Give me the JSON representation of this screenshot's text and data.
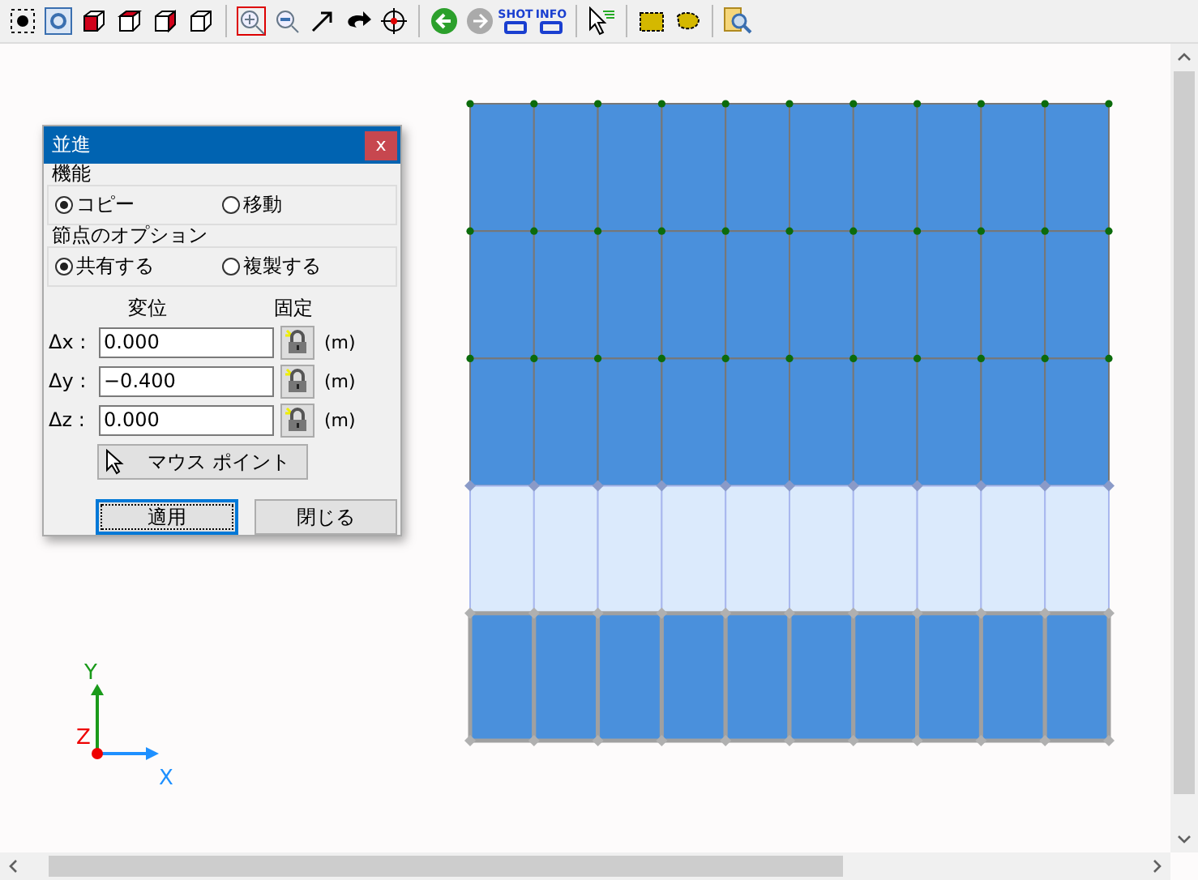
{
  "toolbar": {
    "shot_label": "SHOT",
    "info_label": "INFO"
  },
  "dialog": {
    "title": "並進",
    "close_glyph": "x",
    "function_group": {
      "title": "機能",
      "options": [
        {
          "label": "コピー",
          "selected": true
        },
        {
          "label": "移動",
          "selected": false
        }
      ]
    },
    "node_group": {
      "title": "節点のオプション",
      "options": [
        {
          "label": "共有する",
          "selected": true
        },
        {
          "label": "複製する",
          "selected": false
        }
      ]
    },
    "displacement_header": "変位",
    "fixed_header": "固定",
    "fields": [
      {
        "label": "Δx :",
        "value": "0.000",
        "unit": "(m)"
      },
      {
        "label": "Δy :",
        "value": "−0.400",
        "unit": "(m)"
      },
      {
        "label": "Δz :",
        "value": "0.000",
        "unit": "(m)"
      }
    ],
    "mouse_point_button": "マウス ポイント",
    "apply_button": "適用",
    "close_button": "閉じる"
  },
  "mesh": {
    "rows": [
      {
        "kind": "solid"
      },
      {
        "kind": "solid"
      },
      {
        "kind": "solid"
      },
      {
        "kind": "light"
      },
      {
        "kind": "framed"
      }
    ]
  },
  "axes": {
    "x": "X",
    "y": "Y",
    "z": "Z"
  }
}
